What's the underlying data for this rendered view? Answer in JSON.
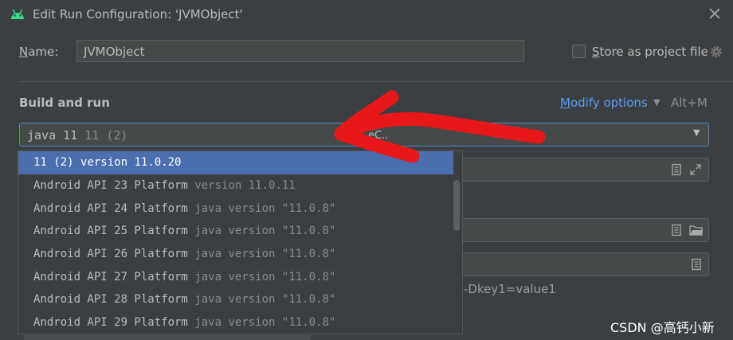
{
  "window": {
    "title": "Edit Run Configuration: 'JVMObject'"
  },
  "name_row": {
    "label_first": "N",
    "label_rest": "ame:",
    "value": "JVMObject",
    "store_first": "S",
    "store_rest": "tore as project file"
  },
  "build_run": {
    "title": "Build and run",
    "modify_first": "M",
    "modify_rest": "odify options",
    "shortcut": "Alt+M",
    "jdk_main": "java 11",
    "jdk_dim": "11 (2)",
    "partial_text": "eC..",
    "vm_hint": "-Dkey1=value1"
  },
  "dropdown": {
    "items": [
      {
        "main": "11 (2)",
        "dim": "version 11.0.20",
        "selected": true
      },
      {
        "main": "Android API 23 Platform",
        "dim": "version 11.0.11",
        "selected": false
      },
      {
        "main": "Android API 24 Platform",
        "dim": "java version \"11.0.8\"",
        "selected": false
      },
      {
        "main": "Android API 25 Platform",
        "dim": "java version \"11.0.8\"",
        "selected": false
      },
      {
        "main": "Android API 26 Platform",
        "dim": "java version \"11.0.8\"",
        "selected": false
      },
      {
        "main": "Android API 27 Platform",
        "dim": "java version \"11.0.8\"",
        "selected": false
      },
      {
        "main": "Android API 28 Platform",
        "dim": "java version \"11.0.8\"",
        "selected": false
      },
      {
        "main": "Android API 29 Platform",
        "dim": "java version \"11.0.8\"",
        "selected": false
      }
    ]
  },
  "icons": {
    "app": "android-icon",
    "close": "close-icon",
    "gear": "gear-icon",
    "doc": "document-icon",
    "expand": "expand-icon",
    "folder": "folder-icon"
  },
  "colors": {
    "accent": "#589df6",
    "selection": "#4b6eaf",
    "annotation": "#e8181a"
  },
  "watermark": "CSDN @高钙小新"
}
